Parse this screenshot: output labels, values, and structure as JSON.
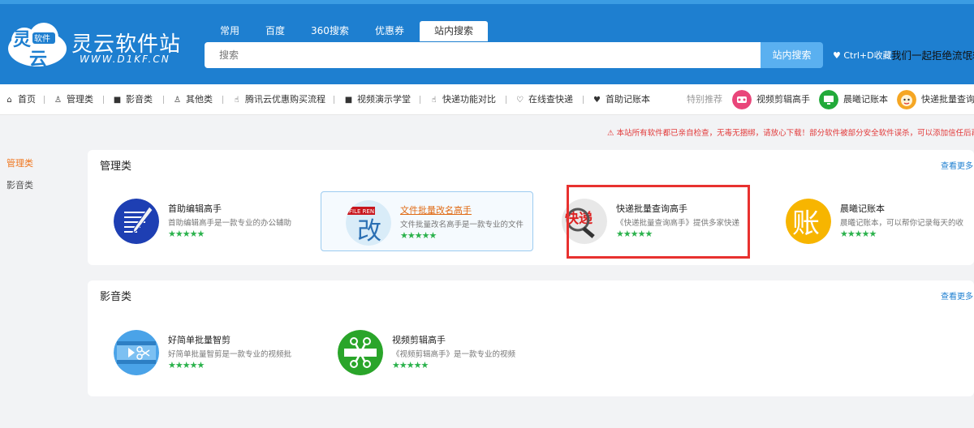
{
  "logo": {
    "title": "灵云软件站",
    "sub": "WWW.D1KF.CN",
    "badge_top": "灵",
    "badge_mid": "软件",
    "badge_bottom": "云"
  },
  "search": {
    "tabs": [
      "常用",
      "百度",
      "360搜索",
      "优惠券",
      "站内搜索"
    ],
    "active_tab": "站内搜索",
    "placeholder": "搜索",
    "button": "站内搜索"
  },
  "header": {
    "fav_text": "♥ Ctrl+D收藏",
    "slogan": "我们一起拒绝流氓软"
  },
  "nav": {
    "items": [
      {
        "icon": "home-icon",
        "label": "首页"
      },
      {
        "icon": "user-icon",
        "label": "管理类"
      },
      {
        "icon": "video-icon",
        "label": "影音类"
      },
      {
        "icon": "user-icon",
        "label": "其他类"
      },
      {
        "icon": "thumb-icon",
        "label": "腾讯云优惠购买流程"
      },
      {
        "icon": "video-icon",
        "label": "视频演示学堂"
      },
      {
        "icon": "thumb-icon",
        "label": "快递功能对比"
      },
      {
        "icon": "heart-outline-icon",
        "label": "在线查快递"
      },
      {
        "icon": "heart-icon",
        "label": "首助记账本"
      }
    ],
    "recommend_label": "特别推荐",
    "recommend": [
      "视频剪辑高手",
      "晨曦记账本",
      "快递批量查询"
    ]
  },
  "notice": "本站所有软件都已亲自检查，无毒无捆绑，请放心下载！部分软件被部分安全软件误杀，可以添加信任后再",
  "sidebar": {
    "items": [
      "管理类",
      "影音类"
    ],
    "active": "管理类"
  },
  "sections": [
    {
      "title": "管理类",
      "more": "查看更多",
      "apps": [
        {
          "name": "首助编辑高手",
          "desc": "首助编辑高手是一款专业的办公辅助",
          "stars": "★★★★★"
        },
        {
          "name": "文件批量改名高手",
          "desc": "文件批量改名高手是一款专业的文件",
          "stars": "★★★★★",
          "icon_caption": "FILE REN",
          "icon_char": "改"
        },
        {
          "name": "快递批量查询高手",
          "desc": "《快递批量查询高手》提供多家快递",
          "stars": "★★★★★",
          "icon_char": "快递"
        },
        {
          "name": "晨曦记账本",
          "desc": "晨曦记账本，可以帮你记录每天的收",
          "stars": "★★★★★",
          "icon_char": "账"
        }
      ]
    },
    {
      "title": "影音类",
      "more": "查看更多",
      "apps": [
        {
          "name": "好简单批量智剪",
          "desc": "好简单批量智剪是一款专业的视频批",
          "stars": "★★★★★"
        },
        {
          "name": "视频剪辑高手",
          "desc": "《视频剪辑高手》是一款专业的视频",
          "stars": "★★★★★"
        }
      ]
    }
  ],
  "colors": {
    "header_blue": "#1e7fd0",
    "accent_orange": "#f0761e",
    "star_green": "#2bb24c",
    "highlight_red": "#e8312f"
  }
}
